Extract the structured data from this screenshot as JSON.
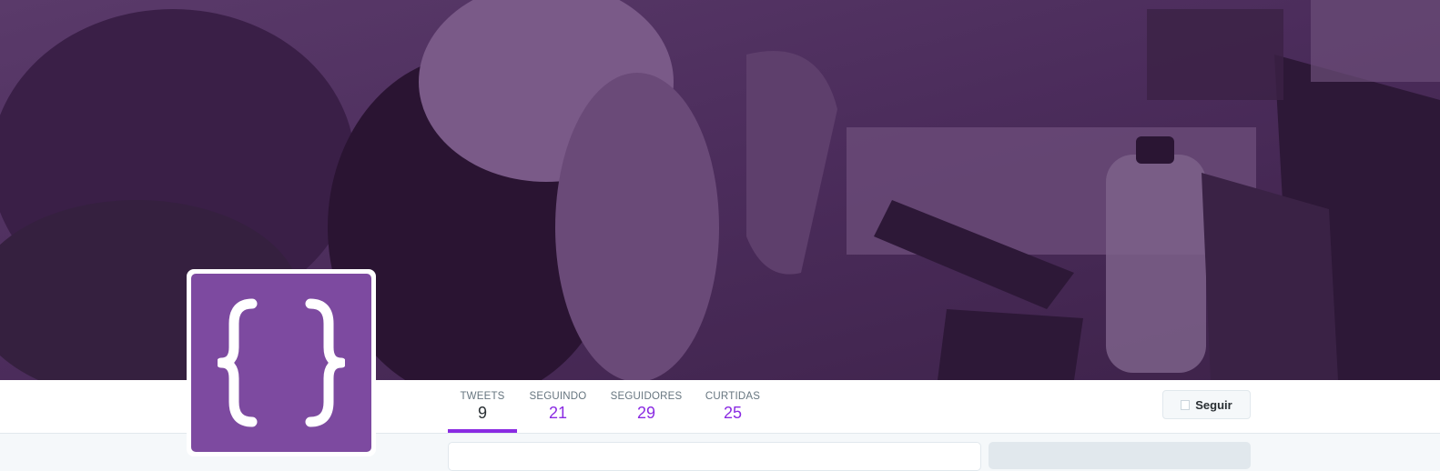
{
  "profile": {
    "banner_tint": "#4a2a5a",
    "avatar_color": "#7d4aa0",
    "avatar_icon": "curly-braces-icon"
  },
  "nav": {
    "accent": "#8a2be2",
    "items": [
      {
        "label": "TWEETS",
        "value": "9"
      },
      {
        "label": "SEGUINDO",
        "value": "21"
      },
      {
        "label": "SEGUIDORES",
        "value": "29"
      },
      {
        "label": "CURTIDAS",
        "value": "25"
      }
    ]
  },
  "follow": {
    "label": "Seguir",
    "icon": "follow-icon"
  }
}
